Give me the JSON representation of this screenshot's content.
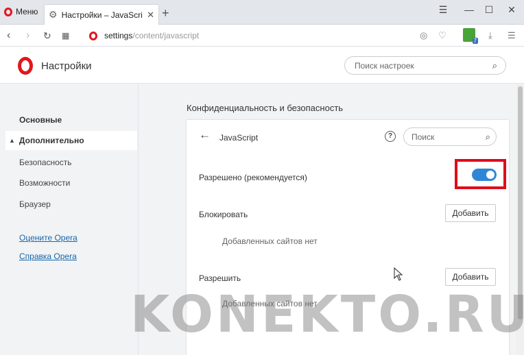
{
  "browser": {
    "menu_label": "Меню",
    "tab_title": "Настройки – JavaScript",
    "new_tab": "+",
    "url_host": "settings",
    "url_path": "/content/javascript",
    "extension_badge": "7"
  },
  "header": {
    "title": "Настройки",
    "search_placeholder": "Поиск настроек"
  },
  "sidebar": {
    "items": [
      {
        "label": "Основные"
      },
      {
        "label": "Дополнительно"
      },
      {
        "label": "Безопасность"
      },
      {
        "label": "Возможности"
      },
      {
        "label": "Браузер"
      }
    ],
    "links": [
      {
        "label": "Оцените Opera"
      },
      {
        "label": "Справка Opera"
      }
    ]
  },
  "main": {
    "section_title": "Конфиденциальность и безопасность",
    "card": {
      "title": "JavaScript",
      "search_placeholder": "Поиск",
      "allowed_label": "Разрешено (рекомендуется)",
      "allowed_on": true,
      "block_label": "Блокировать",
      "block_add": "Добавить",
      "block_empty": "Добавленных сайтов нет",
      "allow_label": "Разрешить",
      "allow_add": "Добавить",
      "allow_empty": "Добавленных сайтов нет"
    }
  },
  "watermark": "KONEKTO.RU",
  "colors": {
    "opera_red": "#e0171e",
    "toggle_blue": "#2f86d6",
    "highlight_red": "#e00b1b",
    "link_blue": "#1565a8"
  }
}
